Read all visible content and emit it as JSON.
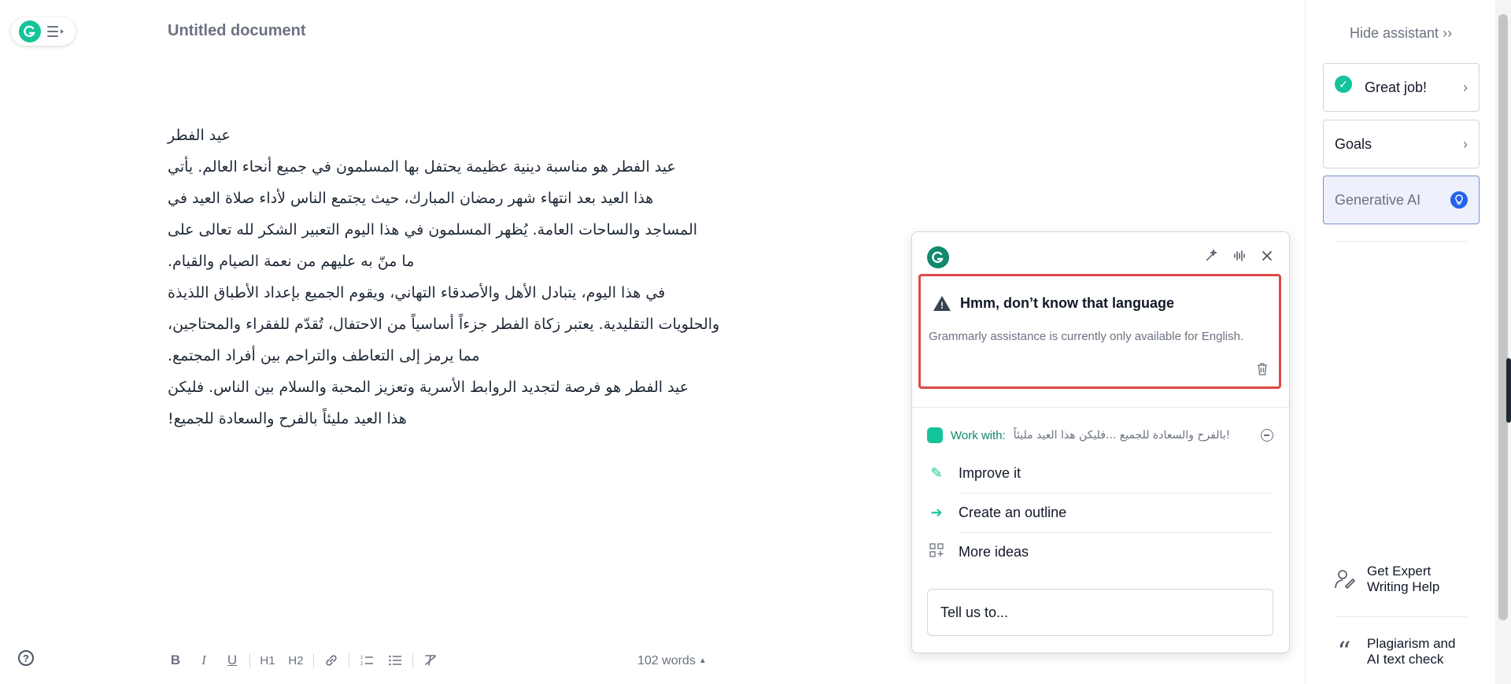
{
  "document": {
    "title": "Untitled document",
    "lines": [
      "عيد الفطر",
      "عيد الفطر هو مناسبة دينية عظيمة يحتفل بها المسلمون في جميع أنحاء العالم. يأتي",
      "هذا العيد بعد انتهاء شهر رمضان المبارك، حيث يجتمع الناس لأداء صلاة العيد في",
      "المساجد والساحات العامة. يُظهر المسلمون في هذا اليوم التعبير الشكر لله تعالى على",
      "ما منّ به عليهم من نعمة الصيام والقيام.",
      "في هذا اليوم، يتبادل الأهل والأصدقاء التهاني، ويقوم الجميع بإعداد الأطباق اللذيذة",
      "والحلويات التقليدية. يعتبر زكاة الفطر جزءاً أساسياً من الاحتفال، تُقدّم للفقراء والمحتاجين،",
      "مما يرمز إلى التعاطف والتراحم بين أفراد المجتمع.",
      "عيد الفطر هو فرصة لتجديد الروابط الأسرية وتعزيز المحبة والسلام بين الناس. فليكن",
      "هذا العيد مليئاً بالفرح والسعادة للجميع!"
    ]
  },
  "toolbar": {
    "bold": "B",
    "italic": "I",
    "underline": "U",
    "h1": "H1",
    "h2": "H2",
    "word_count": "102 words"
  },
  "assistant": {
    "hide_label": "Hide assistant",
    "great_job": "Great job!",
    "goals": "Goals",
    "generative_ai": "Generative AI",
    "expert_help": "Get Expert Writing Help",
    "plagiarism": "Plagiarism and AI text check"
  },
  "popup": {
    "alert_title": "Hmm, don’t know that language",
    "alert_desc": "Grammarly assistance is currently only available for English.",
    "work_with_label": "Work with:",
    "work_with_text": "بالفرح والسعادة للجميع ...فليكن هذا العيد مليئاً!",
    "actions": [
      "Improve it",
      "Create an outline",
      "More ideas"
    ],
    "input_placeholder": "Tell us to..."
  },
  "colors": {
    "brand_green": "#15c39a",
    "alert_red": "#e04848",
    "gen_ai_blue": "#2563eb"
  },
  "icons": [
    "grammarly-logo-icon",
    "menu-icon",
    "help-icon",
    "check-circle-icon",
    "chevron-right-icon",
    "lightbulb-icon",
    "warning-icon",
    "trash-icon",
    "sparkle-icon",
    "voice-icon",
    "close-icon"
  ]
}
